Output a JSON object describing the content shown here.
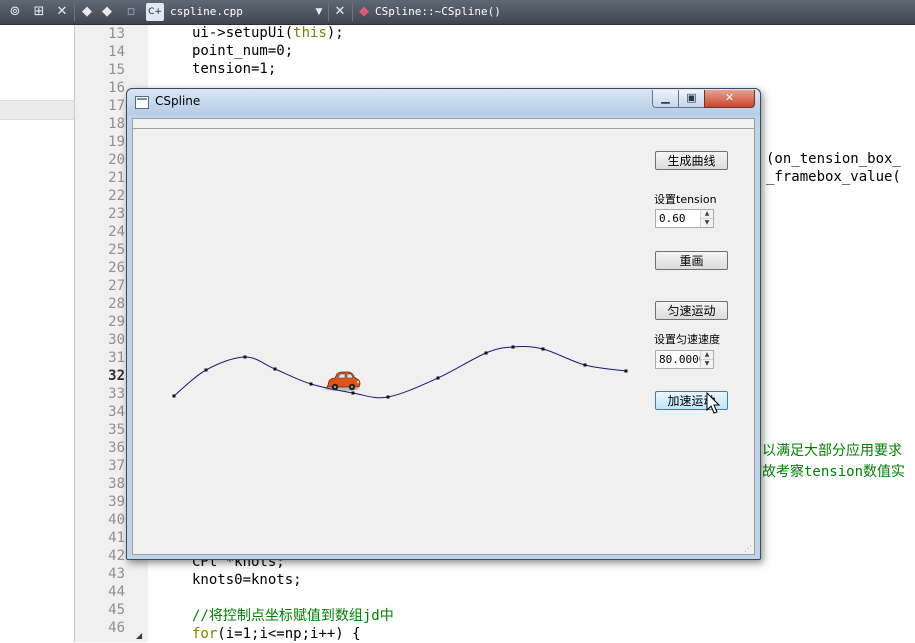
{
  "ide": {
    "file_tab": "cspline.cpp",
    "function_tab": "CSpline::~CSpline()"
  },
  "gutter": {
    "line_numbers": [
      "13",
      "14",
      "15",
      "16",
      "17",
      "18",
      "19",
      "20",
      "21",
      "22",
      "23",
      "24",
      "25",
      "26",
      "27",
      "28",
      "29",
      "30",
      "31",
      "32",
      "33",
      "34",
      "35",
      "36",
      "37",
      "38",
      "39",
      "40",
      "41",
      "42",
      "43",
      "44",
      "45",
      "46"
    ],
    "current_line": "32"
  },
  "code": {
    "l13": "ui->setupUi(",
    "l13_kw": "this",
    "l13_end": ");",
    "l14": "point_num=0;",
    "l15": "tension=1;",
    "l20_right": "(on_tension_box_",
    "l21_right": "_framebox_value(",
    "l36_right": "以满足大部分应用要求",
    "l37_right": "故考察tension数值实",
    "l42": "CPt *knots;",
    "l43": "knots0=knots;",
    "l45": "//将控制点坐标赋值到数组jd中",
    "l46_kw": "for",
    "l46": "(i=1;i<=np;i++) {"
  },
  "window": {
    "title": "CSpline",
    "buttons": {
      "generate": "生成曲线",
      "redraw": "重画",
      "uniform": "匀速运动",
      "accel": "加速运动"
    },
    "labels": {
      "tension": "设置tension",
      "speed": "设置匀速速度"
    },
    "tension_value": "0.60",
    "speed_value": "80.0000"
  },
  "colors": {
    "curve": "#1a1a7a",
    "car_body": "#e0541a",
    "code_keyword": "#808000",
    "code_comment": "#008000"
  },
  "icons": {
    "cursor": "arrow-cursor-icon",
    "car": "car-icon"
  }
}
